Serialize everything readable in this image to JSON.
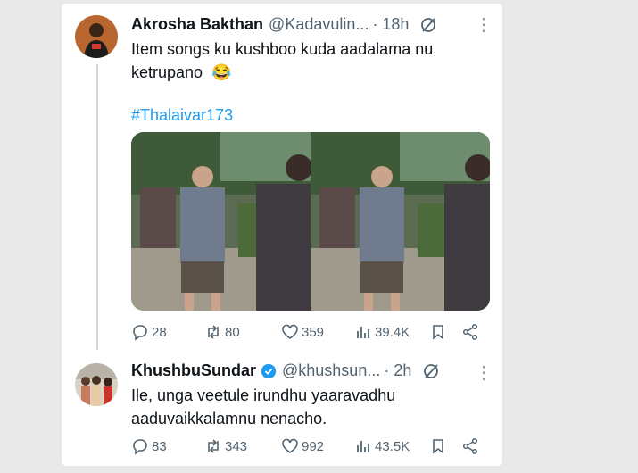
{
  "tweet1": {
    "name": "Akrosha Bakthan",
    "handle": "@Kadavulin...",
    "time": "· 18h",
    "text_line1": "Item songs ku kushboo kuda aadalama nu",
    "text_line2": "ketrupano",
    "emoji": "😂",
    "hashtag": "#Thalaivar173",
    "replies": "28",
    "reposts": "80",
    "likes": "359",
    "views": "39.4K"
  },
  "tweet2": {
    "name": "KhushbuSundar",
    "handle": "@khushsun...",
    "time": "· 2h",
    "text_line1": "Ile, unga veetule irundhu yaaravadhu",
    "text_line2": "aaduvaikkalamnu nenacho.",
    "replies": "83",
    "reposts": "343",
    "likes": "992",
    "views": "43.5K"
  },
  "icons": {
    "reply": "reply-icon",
    "repost": "repost-icon",
    "like": "like-icon",
    "views": "views-icon",
    "bookmark": "bookmark-icon",
    "share": "share-icon",
    "grok": "grok-icon",
    "more": "more-icon"
  },
  "colors": {
    "link": "#1d9bf0",
    "secondary": "#536471",
    "verified": "#1d9bf0"
  }
}
